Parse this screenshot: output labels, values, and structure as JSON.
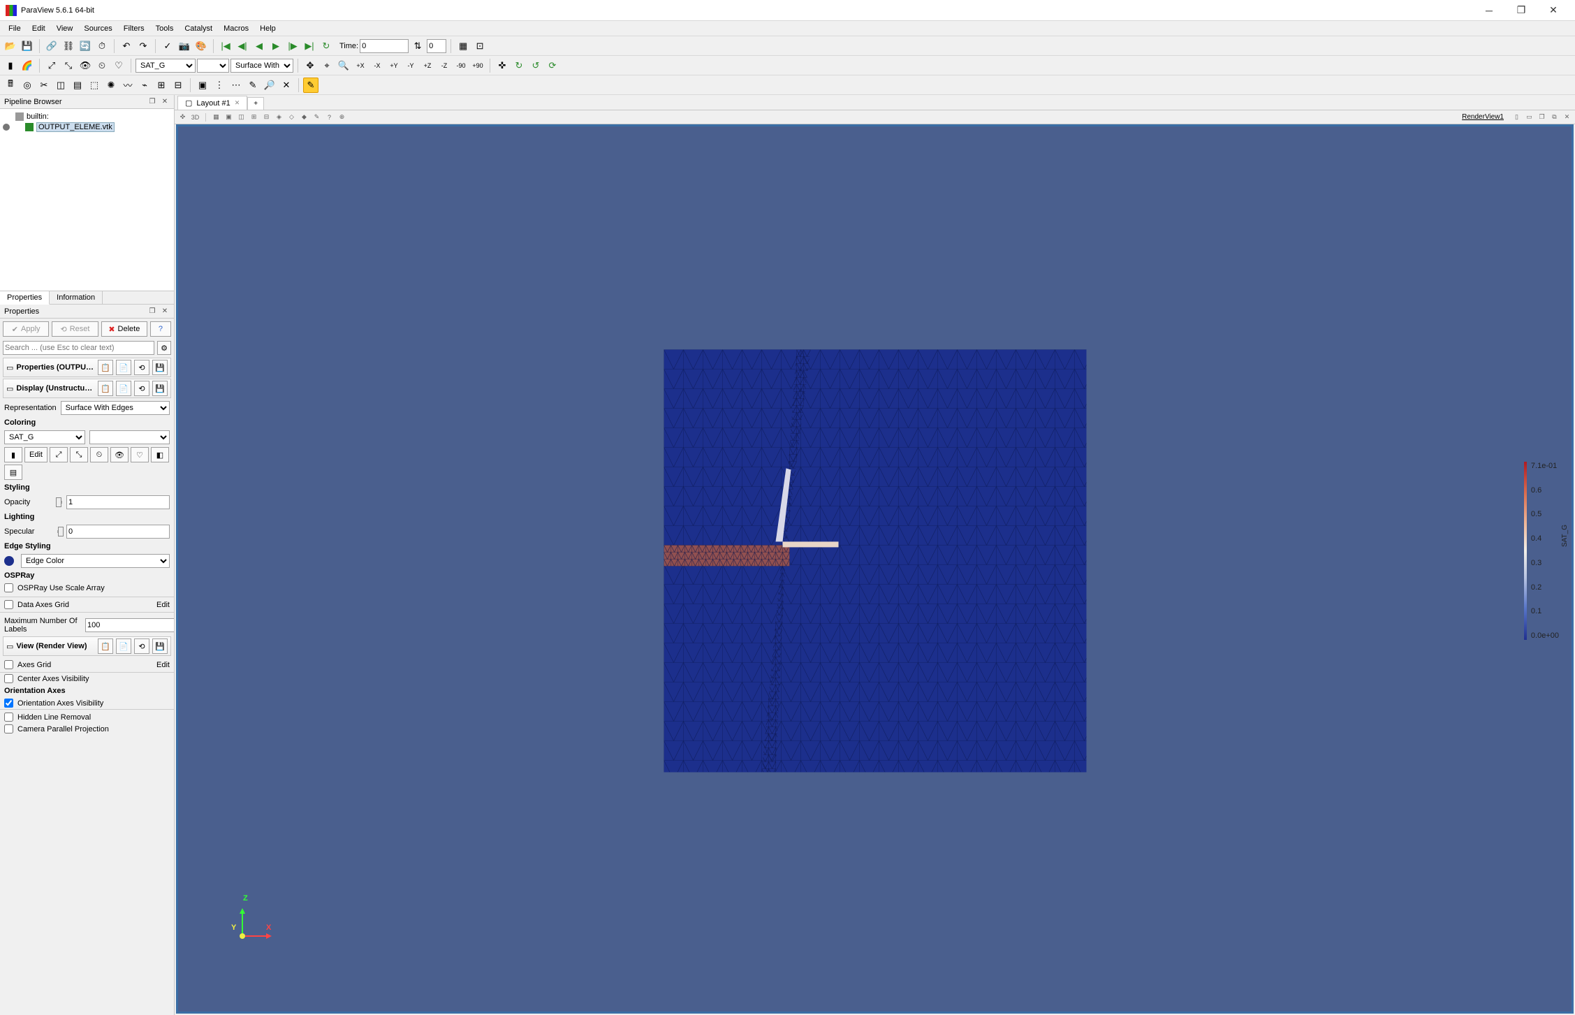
{
  "window": {
    "title": "ParaView 5.6.1 64-bit"
  },
  "menu": [
    "File",
    "Edit",
    "View",
    "Sources",
    "Filters",
    "Tools",
    "Catalyst",
    "Macros",
    "Help"
  ],
  "toolbar": {
    "time_label": "Time:",
    "time_value": "0",
    "time_index": "0",
    "array_select": "SAT_G",
    "representation_select": "Surface With Edges"
  },
  "pipeline": {
    "title": "Pipeline Browser",
    "root": "builtin:",
    "items": [
      {
        "name": "OUTPUT_ELEME.vtk",
        "visible": true,
        "selected": true
      }
    ]
  },
  "tabs": {
    "properties": "Properties",
    "information": "Information"
  },
  "props_panel": {
    "title": "Properties",
    "apply": "Apply",
    "reset": "Reset",
    "delete": "Delete",
    "help": "?",
    "search_placeholder": "Search ... (use Esc to clear text)",
    "section_props": "Properties (OUTPUT_ELEME.vtk)",
    "section_display": "Display (UnstructuredGridRepresentation)",
    "representation_label": "Representation",
    "representation_value": "Surface With Edges",
    "coloring_label": "Coloring",
    "coloring_value": "SAT_G",
    "edit_label": "Edit",
    "styling_label": "Styling",
    "opacity_label": "Opacity",
    "opacity_value": "1",
    "lighting_label": "Lighting",
    "specular_label": "Specular",
    "specular_value": "0",
    "edge_styling_label": "Edge Styling",
    "edge_color_label": "Edge Color",
    "ospray_label": "OSPRay",
    "ospray_scale": "OSPRay Use Scale Array",
    "data_axes_grid": "Data Axes Grid",
    "edit_btn": "Edit",
    "max_labels": "Maximum Number Of Labels",
    "max_labels_value": "100",
    "section_view": "View (Render View)",
    "axes_grid": "Axes Grid",
    "center_axes": "Center Axes Visibility",
    "orientation_axes_label": "Orientation Axes",
    "orientation_vis": "Orientation Axes Visibility",
    "hidden_line": "Hidden Line Removal",
    "camera_parallel": "Camera Parallel Projection"
  },
  "layout": {
    "tab": "Layout #1",
    "add": "+",
    "render_view_label": "RenderView1"
  },
  "axes3d": {
    "x": "X",
    "y": "Y",
    "z": "Z"
  },
  "colorbar": {
    "title": "SAT_G",
    "ticks": [
      "7.1e-01",
      "0.6",
      "0.5",
      "0.4",
      "0.3",
      "0.2",
      "0.1",
      "0.0e+00"
    ]
  },
  "camera_buttons": [
    "+X",
    "-X",
    "+Y",
    "-Y",
    "+Z",
    "-Z",
    "-90",
    "+90"
  ]
}
